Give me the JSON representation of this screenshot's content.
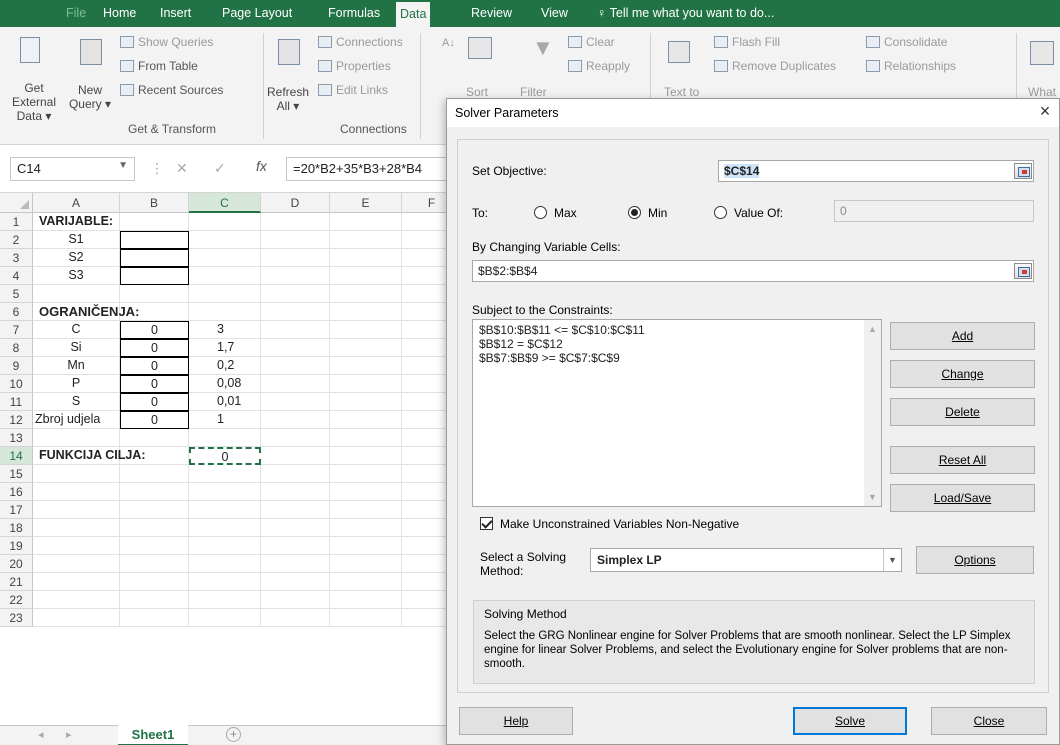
{
  "ribbon": {
    "tabs": [
      "File",
      "Home",
      "Insert",
      "Page Layout",
      "Formulas",
      "Data",
      "Review",
      "View"
    ],
    "tell_me": "Tell me what you want to do...",
    "get_external_data": "Get External Data ▾",
    "new_query": "New Query ▾",
    "show_queries": "Show Queries",
    "from_table": "From Table",
    "recent_sources": "Recent Sources",
    "group_get_transform": "Get & Transform",
    "refresh_all": "Refresh All ▾",
    "connections": "Connections",
    "properties": "Properties",
    "edit_links": "Edit Links",
    "group_connections": "Connections",
    "sort": "Sort",
    "filter": "Filter",
    "clear": "Clear",
    "reapply": "Reapply",
    "text_to": "Text to",
    "flash_fill": "Flash Fill",
    "remove_duplicates": "Remove Duplicates",
    "consolidate": "Consolidate",
    "relationships": "Relationships",
    "what": "What"
  },
  "formula_bar": {
    "name_box": "C14",
    "formula": "=20*B2+35*B3+28*B4"
  },
  "grid": {
    "columns": [
      "A",
      "B",
      "C",
      "D",
      "E",
      "F"
    ],
    "rows": [
      "1",
      "2",
      "3",
      "4",
      "5",
      "6",
      "7",
      "8",
      "9",
      "10",
      "11",
      "12",
      "13",
      "14",
      "15",
      "16",
      "17",
      "18",
      "19",
      "20",
      "21",
      "22",
      "23"
    ],
    "cells": {
      "A1": "VARIJABLE:",
      "A2": "S1",
      "A3": "S2",
      "A4": "S3",
      "A6": "OGRANIČENJA:",
      "A7": "C",
      "A8": "Si",
      "A9": "Mn",
      "A10": "P",
      "A11": "S",
      "A12": "Zbroj udjela",
      "B7": "0",
      "B8": "0",
      "B9": "0",
      "B10": "0",
      "B11": "0",
      "B12": "0",
      "C7": "3",
      "C8": "1,7",
      "C9": "0,2",
      "C10": "0,08",
      "C11": "0,01",
      "C12": "1",
      "A14": "FUNKCIJA CILJA:",
      "C14": "0"
    }
  },
  "sheet_tab": "Sheet1",
  "add_sheet": "+",
  "dialog": {
    "title": "Solver Parameters",
    "close": "×",
    "set_objective_label": "Set Objective:",
    "set_objective_value": "$C$14",
    "to_label": "To:",
    "max_label": "Max",
    "min_label": "Min",
    "value_of_label": "Value Of:",
    "value_of_value": "0",
    "by_changing_label": "By Changing Variable Cells:",
    "by_changing_value": "$B$2:$B$4",
    "subject_label": "Subject to the Constraints:",
    "constraints": [
      "$B$10:$B$11 <= $C$10:$C$11",
      "$B$12 = $C$12",
      "$B$7:$B$9 >= $C$7:$C$9"
    ],
    "add": "Add",
    "change": "Change",
    "delete": "Delete",
    "reset_all": "Reset All",
    "load_save": "Load/Save",
    "make_nonneg": "Make Unconstrained Variables Non-Negative",
    "select_method_label_1": "Select a Solving",
    "select_method_label_2": "Method:",
    "method": "Simplex LP",
    "options": "Options",
    "solving_method_title": "Solving Method",
    "solving_method_text": "Select the GRG Nonlinear engine for Solver Problems that are smooth nonlinear. Select the LP Simplex engine for linear Solver Problems, and select the Evolutionary engine for Solver problems that are non-smooth.",
    "help": "Help",
    "solve": "Solve",
    "close_button": "Close"
  }
}
